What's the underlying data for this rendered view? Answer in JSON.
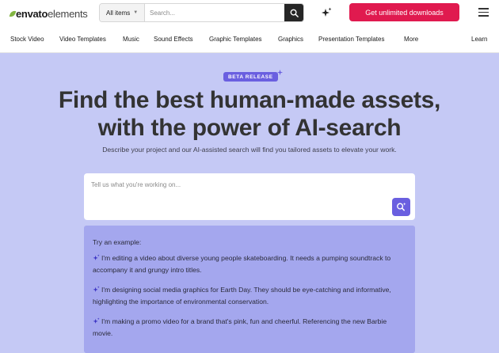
{
  "header": {
    "logo_brand": "envato",
    "logo_product": "elements",
    "category_select": "All items",
    "search_placeholder": "Search...",
    "cta_label": "Get unlimited downloads"
  },
  "nav": {
    "items": [
      "Stock Video",
      "Video Templates",
      "Music",
      "Sound Effects",
      "Graphic Templates",
      "Graphics",
      "Presentation Templates",
      "More",
      "Learn"
    ]
  },
  "hero": {
    "badge": "BETA RELEASE",
    "headline_line1": "Find the best human-made assets,",
    "headline_line2": "with the power of AI-search",
    "subline": "Describe your project and our AI-assisted search will find you tailored assets to elevate your work.",
    "prompt_placeholder": "Tell us what you're working on...",
    "examples_title": "Try an example:",
    "examples": [
      "I'm editing a video about diverse young people skateboarding. It needs a pumping soundtrack to accompany it and grungy intro titles.",
      "I'm designing social media graphics for Earth Day. They should be eye-catching and informative, highlighting the importance of environmental conservation.",
      "I'm making a promo video for a brand that's pink, fun and cheerful. Referencing the new Barbie movie."
    ]
  },
  "colors": {
    "cta": "#e01a4f",
    "hero_bg": "#c5c9f5",
    "accent": "#6a5fe0",
    "examples_bg": "#a4a7ee"
  },
  "icons": [
    "search-icon",
    "ai-sparkle-icon",
    "hamburger-menu-icon",
    "chevron-down-icon",
    "ai-search-icon",
    "sparkle-icon"
  ]
}
